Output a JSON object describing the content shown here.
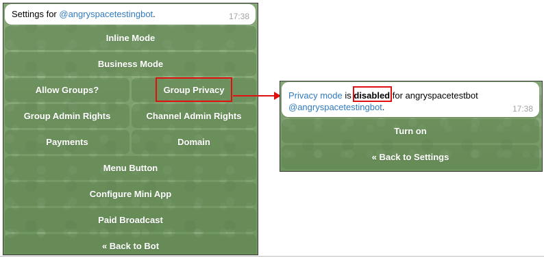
{
  "left": {
    "message": {
      "prefix": "Settings for ",
      "mention": "@angryspacetestingbot",
      "suffix": ".",
      "time": "17:38"
    },
    "buttons": {
      "inline_mode": "Inline Mode",
      "business_mode": "Business Mode",
      "allow_groups": "Allow Groups?",
      "group_privacy": "Group Privacy",
      "group_admin_rights": "Group Admin Rights",
      "channel_admin_rights": "Channel Admin Rights",
      "payments": "Payments",
      "domain": "Domain",
      "menu_button": "Menu Button",
      "configure_mini_app": "Configure Mini App",
      "paid_broadcast": "Paid Broadcast",
      "back_to_bot": "« Back to Bot"
    }
  },
  "right": {
    "message": {
      "privacy_mode": "Privacy mode",
      "is": " is ",
      "status": "disabled",
      "for_text": " for angryspacetestbot",
      "mention": "@angryspacetestingbot",
      "suffix": ".",
      "time": "17:38"
    },
    "buttons": {
      "turn_on": "Turn on",
      "back_to_settings": "« Back to Settings"
    }
  },
  "colors": {
    "highlight": "#e01010",
    "link": "#2f7bbf",
    "chat_background": "#7fa36f"
  }
}
